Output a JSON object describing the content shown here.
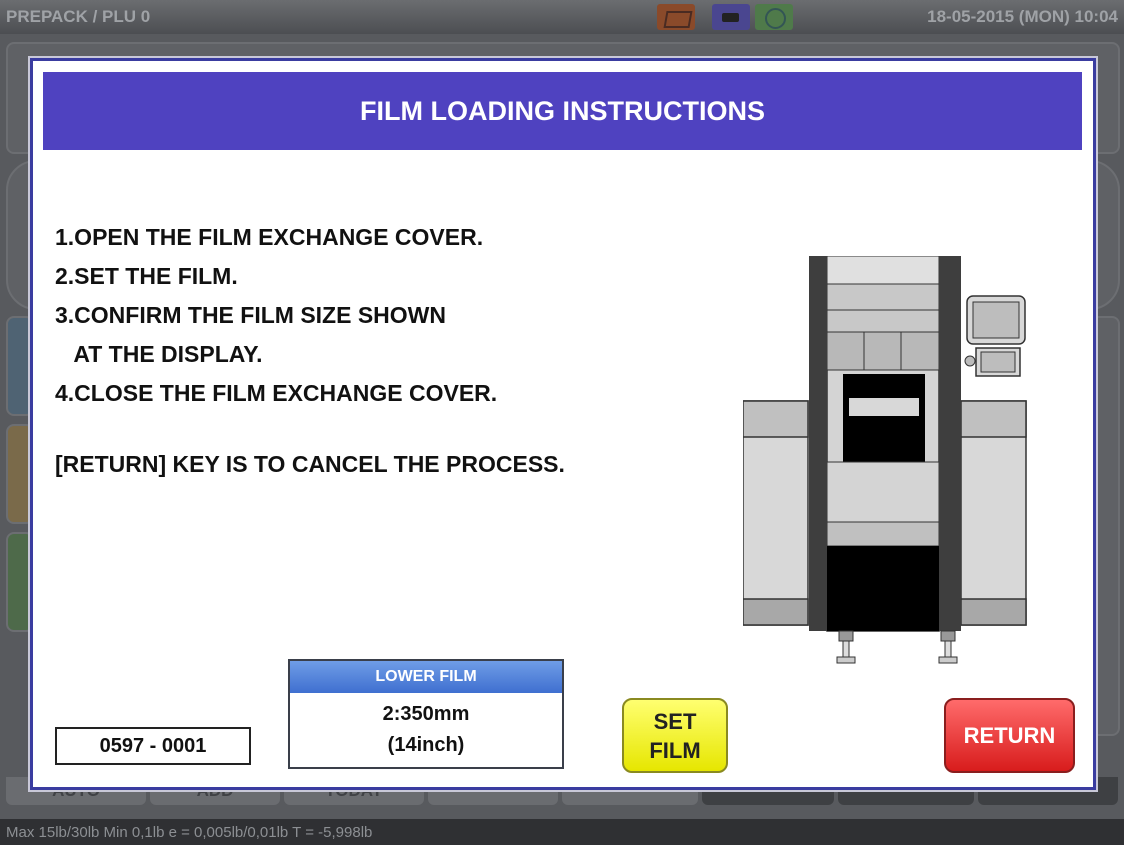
{
  "topbar": {
    "title": "PREPACK / PLU 0",
    "datetime": "18-05-2015 (MON)  10:04"
  },
  "status_icons": [
    "printer-alert-icon",
    "battery-icon",
    "network-icon"
  ],
  "background_tabs": {
    "auto": "AUTO",
    "add": "ADD",
    "today": "TODAY"
  },
  "footer": {
    "text": "Max 15lb/30lb  Min 0,1lb  e = 0,005lb/0,01lb  T = -5,998lb"
  },
  "dialog": {
    "title": "FILM LOADING INSTRUCTIONS",
    "steps": [
      "1.OPEN THE FILM EXCHANGE COVER.",
      "2.SET THE FILM.",
      "3.CONFIRM THE FILM SIZE SHOWN",
      "   AT THE DISPLAY.",
      "4.CLOSE THE FILM EXCHANGE COVER."
    ],
    "cancel_note": "[RETURN] KEY IS TO CANCEL THE PROCESS.",
    "code": "0597 - 0001",
    "film": {
      "label": "LOWER FILM",
      "size": "2:350mm",
      "inch": "(14inch)"
    },
    "buttons": {
      "set_line1": "SET",
      "set_line2": "FILM",
      "return": "RETURN"
    }
  },
  "colors": {
    "header": "#4f42c0",
    "set_button": "#ffff33",
    "return_button": "#e82a2a",
    "film_header": "#4f7fd8"
  }
}
